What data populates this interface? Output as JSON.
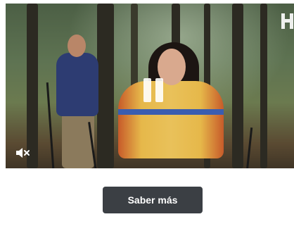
{
  "video": {
    "state": "playing",
    "pause_icon": "pause-icon",
    "mute_icon": "speaker-muted-icon",
    "brand_icon": "brand-logo-icon"
  },
  "cta": {
    "label": "Saber más"
  },
  "colors": {
    "cta_background": "#3b3f44",
    "cta_text": "#ffffff",
    "page_background": "#ffffff"
  }
}
